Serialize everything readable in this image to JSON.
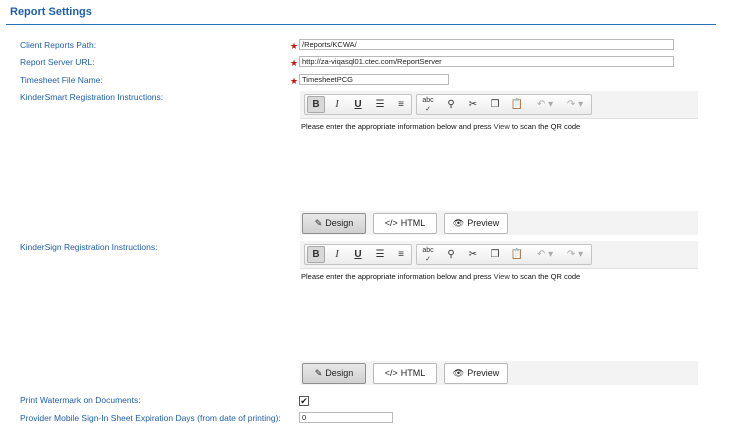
{
  "section": {
    "title": "Report Settings"
  },
  "fields": {
    "client_reports_path": {
      "label": "Client Reports Path:",
      "value": "/Reports/KCWA/"
    },
    "report_server_url": {
      "label": "Report Server URL:",
      "value": "http://za-viqasql01.ctec.com/ReportServer"
    },
    "timesheet_file_name": {
      "label": "Timesheet File Name:",
      "value": "TimesheetPCG"
    },
    "required_mark": "★",
    "print_watermark": {
      "label": "Print Watermark on Documents:",
      "checked": true,
      "check_glyph": "✔"
    },
    "expiration_days": {
      "label": "Provider Mobile Sign-In Sheet Expiration Days (from date of printing):",
      "value": "0"
    }
  },
  "editors": [
    {
      "label": "KinderSmart Registration Instructions:",
      "content_before": "Please enter the appropriate information below and press ",
      "content_keyword": "View",
      "content_after": " to scan the QR code"
    },
    {
      "label": "KinderSign Registration Instructions:",
      "content_before": "Please enter the appropriate information below and press ",
      "content_keyword": "View",
      "content_after": " to scan the QR code"
    }
  ],
  "toolbar": {
    "bold": "B",
    "italic": "I",
    "underline": "U",
    "icons": [
      "bulleted-list-icon",
      "numbered-list-icon",
      "spellcheck-icon",
      "find-icon",
      "cut-icon",
      "copy-icon",
      "paste-icon",
      "undo-icon",
      "redo-icon"
    ],
    "spell_glyph": "abc"
  },
  "modes": {
    "design": "Design",
    "html": "HTML",
    "preview": "Preview",
    "html_glyph": "</>"
  },
  "colors": {
    "label": "#1f5fa8",
    "title": "#1f5fa8",
    "required": "#cc1111",
    "rule": "#2b6cb6"
  }
}
